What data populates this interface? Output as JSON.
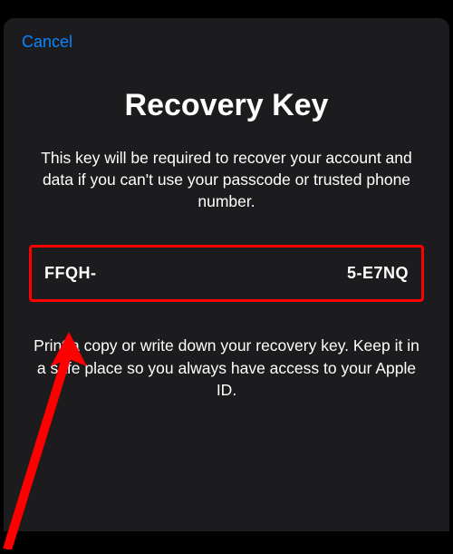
{
  "header": {
    "cancel_label": "Cancel"
  },
  "main": {
    "title": "Recovery Key",
    "description": "This key will be required to recover your account and data if you can't use your passcode or trusted phone number.",
    "key_prefix": "FFQH-",
    "key_suffix": "5-E7NQ",
    "instructions": "Print a copy or write down your recovery key. Keep it in a safe place so you always have access to your Apple ID."
  },
  "annotation": {
    "highlight_color": "#ff0000",
    "arrow_color": "#ff0000"
  }
}
